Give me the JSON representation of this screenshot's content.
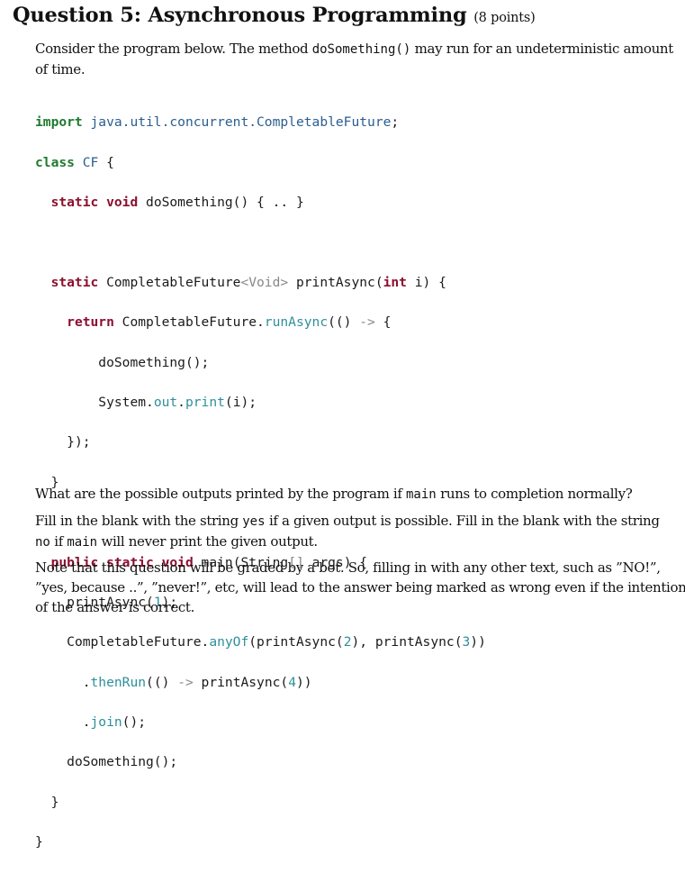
{
  "question": {
    "title": "Question 5: Asynchronous Programming",
    "points": "(8 points)"
  },
  "intro": {
    "text_before": "Consider the program below. The method ",
    "method": "doSomething()",
    "text_after": " may run for an undeterministic amount",
    "line2": "of time."
  },
  "code": {
    "l1_import": "import",
    "l1_pkg": "java.util.concurrent.CompletableFuture",
    "l1_end": ";",
    "l2_class": "class",
    "l2_name": "CF",
    "l2_brace": " {",
    "l3_static": "static",
    "l3_void": "void",
    "l3_rest": " doSomething() { .. }",
    "l5_static": "static",
    "l5_type": " CompletableFuture",
    "l5_generic": "<Void>",
    "l5_name": " printAsync(",
    "l5_int": "int",
    "l5_rest": " i) {",
    "l6_return": "return",
    "l6_cf": " CompletableFuture.",
    "l6_method": "runAsync",
    "l6_args": "(() ",
    "l6_arrow": "->",
    "l6_brace": " {",
    "l7": "doSomething();",
    "l8_sys": "System.",
    "l8_out": "out",
    "l8_dot": ".",
    "l8_print": "print",
    "l8_rest": "(i);",
    "l9": "});",
    "l10": "}",
    "l12_public": "public",
    "l12_static": "static",
    "l12_void": "void",
    "l12_main": " main(String",
    "l12_br": "[]",
    "l12_rest": " args) {",
    "l13_call": "printAsync(",
    "l13_num": "1",
    "l13_end": ");",
    "l14_cf": "CompletableFuture.",
    "l14_anyof": "anyOf",
    "l14_a": "(printAsync(",
    "l14_n2": "2",
    "l14_b": "), printAsync(",
    "l14_n3": "3",
    "l14_c": "))",
    "l15_dot": ".",
    "l15_then": "thenRun",
    "l15_a": "(() ",
    "l15_arrow": "->",
    "l15_b": " printAsync(",
    "l15_n4": "4",
    "l15_c": "))",
    "l16_dot": ".",
    "l16_join": "join",
    "l16_rest": "();",
    "l17": "doSomething();",
    "l18": "}",
    "l19": "}"
  },
  "question_text": {
    "a": "What are the possible outputs printed by the program if ",
    "main": "main",
    "b": " runs to completion normally?"
  },
  "instructions": {
    "p1_a": "Fill in the blank with the string ",
    "yes": "yes",
    "p1_b": " if a given output is possible. Fill in the blank with the string",
    "no": "no",
    "p1_c": " if ",
    "main": "main",
    "p1_d": " will never print the given output."
  },
  "note": {
    "l1": "Note that this question will be graded by a bot. So, filling in with any other text, such as ”NO!”,",
    "l2": "”yes, because ..”, ”never!”, etc, will lead to the answer being marked as wrong even if the intention",
    "l3": "of the answer is correct."
  }
}
